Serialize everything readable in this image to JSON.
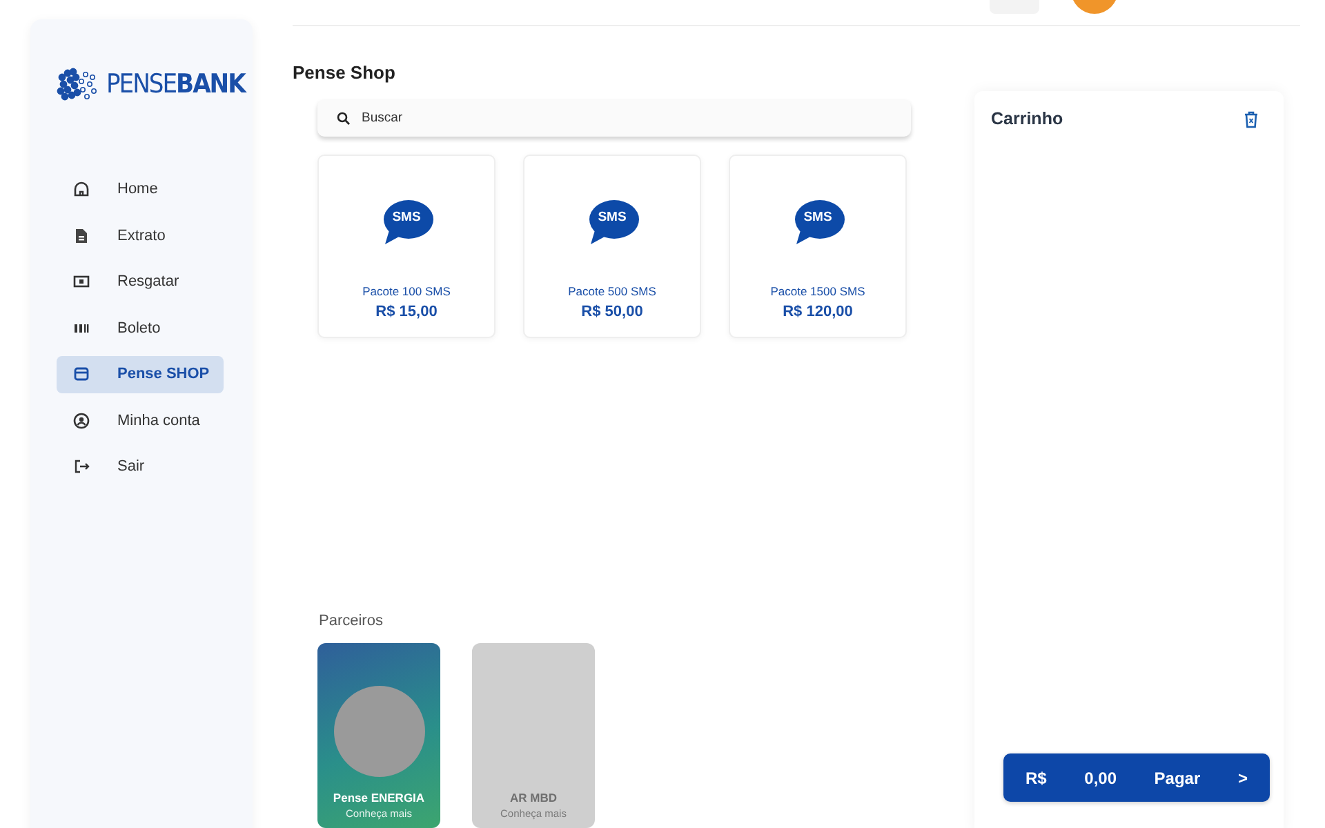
{
  "brand": {
    "logo_text": "PENSE**BANK**"
  },
  "sidebar": {
    "items": [
      {
        "label": "Home",
        "selected": false
      },
      {
        "label": "Extrato",
        "selected": false
      },
      {
        "label": "Resgatar",
        "selected": false
      },
      {
        "label": "Boleto",
        "selected": false
      },
      {
        "label": "Pense SHOP",
        "selected": true
      },
      {
        "label": "Minha conta",
        "selected": false
      },
      {
        "label": "Sair",
        "selected": false
      }
    ]
  },
  "page": {
    "title": "Pense Shop"
  },
  "search": {
    "placeholder": "Buscar"
  },
  "products": [
    {
      "icon_text": "SMS",
      "name": "Pacote 100 SMS",
      "price": "R$ 15,00"
    },
    {
      "icon_text": "SMS",
      "name": "Pacote 500 SMS",
      "price": "R$ 50,00"
    },
    {
      "icon_text": "SMS",
      "name": "Pacote 1500 SMS",
      "price": "R$ 120,00"
    }
  ],
  "partners": {
    "title": "Parceiros",
    "items": [
      {
        "kind": "photo",
        "name": "Pense ENERGIA",
        "link": "Conheça mais"
      },
      {
        "kind": "empty",
        "name": "AR MBD",
        "link": "Conheça mais"
      }
    ]
  },
  "cart": {
    "title": "Carrinho",
    "pay_button": {
      "currency": "R$",
      "total": "0,00",
      "label": "Pagar",
      "arrow": ">"
    }
  }
}
